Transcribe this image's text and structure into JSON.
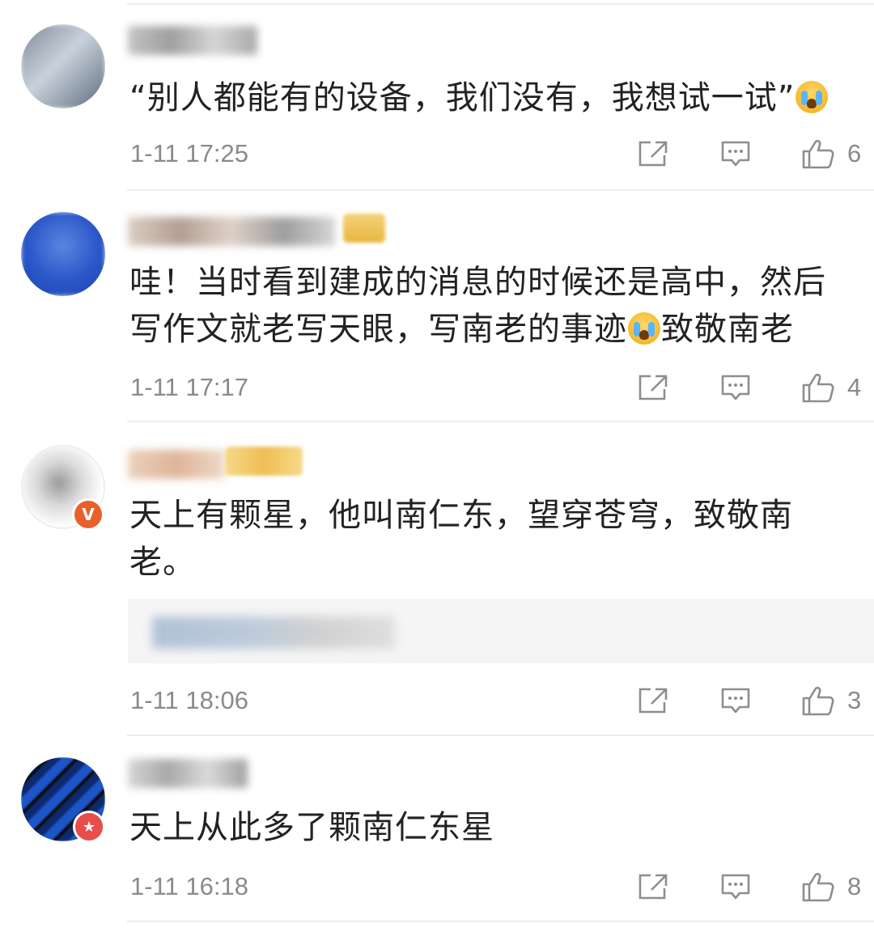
{
  "comments": [
    {
      "text": "“别人都能有的设备，我们没有，我想试一试”",
      "has_emoji": true,
      "time": "1-11 17:25",
      "likes": "6"
    },
    {
      "text_line1": "哇！当时看到建成的消息的时候还是高中，然后",
      "text_line2_a": "写作文就老写天眼，写南老的事迹",
      "text_line2_b": "致敬南老",
      "time": "1-11 17:17",
      "likes": "4"
    },
    {
      "text_line1": "天上有颗星，他叫南仁东，望穿苍穹，致敬南",
      "text_line2": "老。",
      "badge": "V",
      "time": "1-11 18:06",
      "likes": "3"
    },
    {
      "text": "天上从此多了颗南仁东星",
      "time": "1-11 16:18",
      "likes": "8"
    }
  ],
  "icons": {
    "share": "share-icon",
    "comment": "comment-icon",
    "like": "thumbs-up-icon"
  },
  "colors": {
    "time_text": "#8a8a8a",
    "body_text": "#222222",
    "verified_badge": "#e8612c",
    "star_badge": "#e84d4d",
    "divider": "#ececec"
  }
}
